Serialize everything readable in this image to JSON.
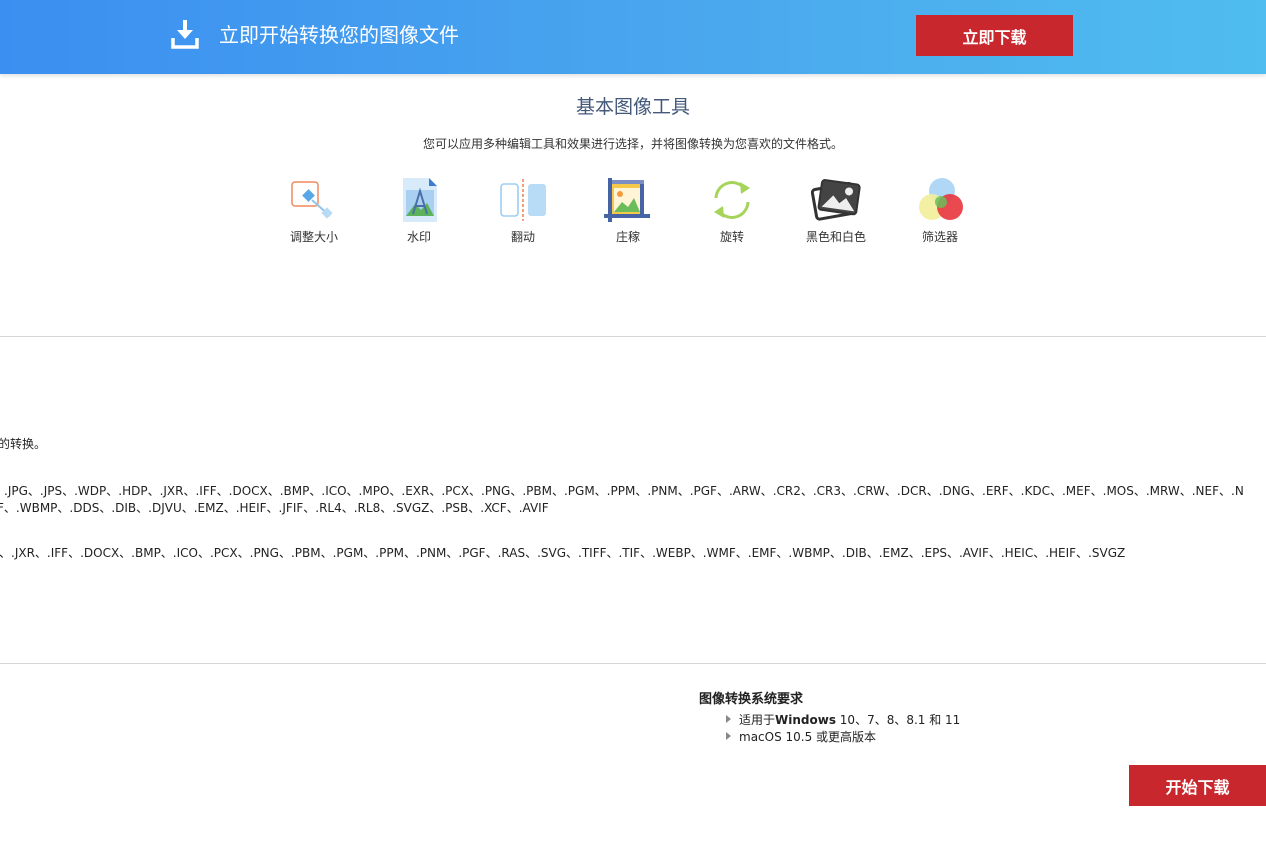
{
  "banner": {
    "icon": "download-icon",
    "title": "立即开始转换您的图像文件",
    "button_label": "立即下载"
  },
  "tools_section": {
    "title": "基本图像工具",
    "subtitle": "您可以应用多种编辑工具和效果进行选择，并将图像转换为您喜欢的文件格式。",
    "tools": [
      {
        "label": "调整大小",
        "icon": "resize-icon"
      },
      {
        "label": "水印",
        "icon": "watermark-icon"
      },
      {
        "label": "翻动",
        "icon": "flip-icon"
      },
      {
        "label": "庄稼",
        "icon": "crop-icon"
      },
      {
        "label": "旋转",
        "icon": "rotate-icon"
      },
      {
        "label": "黑色和白色",
        "icon": "black-white-icon"
      },
      {
        "label": "筛选器",
        "icon": "filter-icon"
      }
    ]
  },
  "formats_section": {
    "intro_fragment": "的转换。",
    "input_formats_line1": ".JPG、.JPS、.WDP、.HDP、.JXR、.IFF、.DOCX、.BMP、.ICO、.MPO、.EXR、.PCX、.PNG、.PBM、.PGM、.PPM、.PNM、.PGF、.ARW、.CR2、.CR3、.CRW、.DCR、.DNG、.ERF、.KDC、.MEF、.MOS、.MRW、.NEF、.N",
    "input_formats_line2": "F、.WBMP、.DDS、.DIB、.DJVU、.EMZ、.HEIF、.JFIF、.RL4、.RL8、.SVGZ、.PSB、.XCF、.AVIF",
    "output_formats": "、.JXR、.IFF、.DOCX、.BMP、.ICO、.PCX、.PNG、.PBM、.PGM、.PPM、.PNM、.PGF、.RAS、.SVG、.TIFF、.TIF、.WEBP、.WMF、.EMF、.WBMP、.DIB、.EMZ、.EPS、.AVIF、.HEIC、.HEIF、.SVGZ"
  },
  "requirements": {
    "title": "图像转换系统要求",
    "windows_prefix": "适用于",
    "windows_bold": "Windows",
    "windows_versions": " 10、7、8、8.1 和 11",
    "mac": "macOS 10.5 或更高版本"
  },
  "start_button_label": "开始下载"
}
